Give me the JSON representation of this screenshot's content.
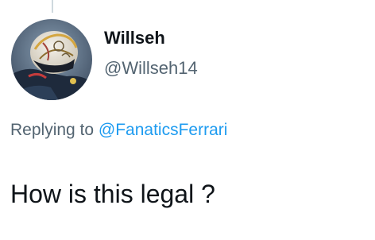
{
  "tweet": {
    "author": {
      "display_name": "Willseh",
      "handle": "@Willseh14",
      "avatar_icon": "helmet-avatar"
    },
    "reply_context": {
      "prefix": "Replying to",
      "mention": "@FanaticsFerrari"
    },
    "text": "How is this legal ?"
  },
  "colors": {
    "text_primary": "#0f1419",
    "text_secondary": "#536471",
    "link": "#1d9bf0",
    "thread_line": "#cfd9de"
  }
}
